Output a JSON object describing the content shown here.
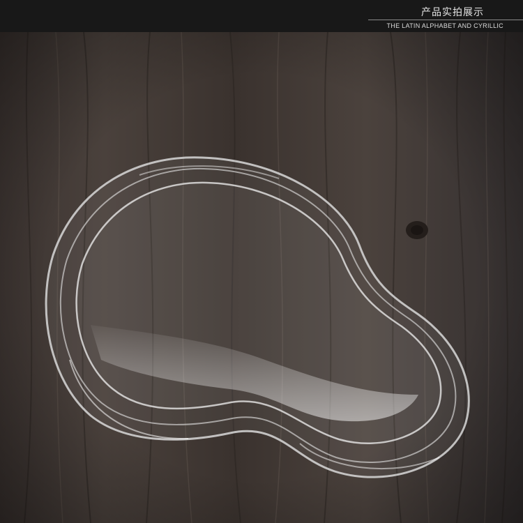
{
  "banner": {
    "title": "产品实拍展示",
    "subtitle": "THE LATIN ALPHABET AND CYRILLIC"
  },
  "photo": {
    "subject": "clear-plastic-lid",
    "background": "dark-wood-table",
    "colors": {
      "wood_dark": "#2e2724",
      "wood_mid": "#4a403b",
      "wood_light": "#6a5e57",
      "banner": "#181818"
    }
  }
}
